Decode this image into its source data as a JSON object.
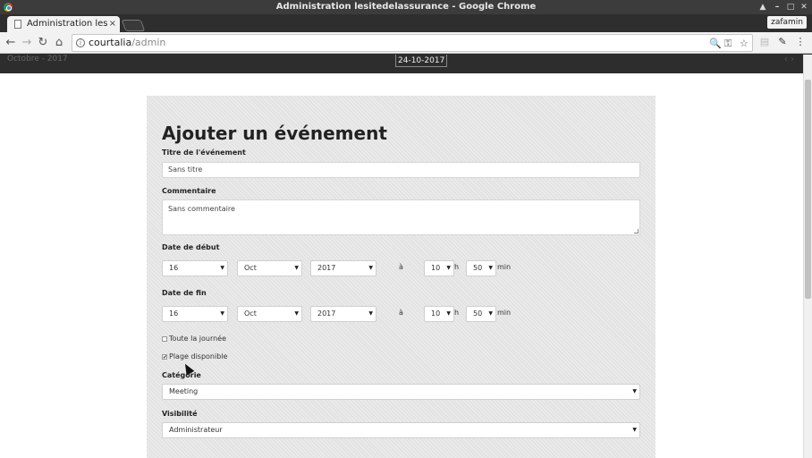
{
  "window": {
    "title": "Administration lesitedelassurance - Google Chrome",
    "controls": [
      "▲",
      "–",
      "□",
      "✕"
    ]
  },
  "tabs": [
    {
      "label": "Administration lesit",
      "close": "×"
    }
  ],
  "profile": {
    "name": "zafamin"
  },
  "toolbar": {
    "back": "←",
    "forward": "→",
    "reload": "↻",
    "home": "⌂",
    "url_host": "courtalia",
    "url_path": "/admin",
    "info": "i",
    "zoom_icon": "🔍",
    "key_icon": "⚿",
    "star_icon": "☆",
    "menu_icon": "⋮"
  },
  "calendar_bar": {
    "month": "Octobre - 2017",
    "date": "24-10-2017",
    "arrows": "‹ ›"
  },
  "form": {
    "title": "Ajouter un événement",
    "event_title": {
      "label": "Titre de l'événement",
      "value": "Sans titre"
    },
    "comment": {
      "label": "Commentaire",
      "value": "Sans commentaire"
    },
    "start": {
      "label": "Date de début",
      "day": "16",
      "month": "Oct",
      "year": "2017",
      "at": "à",
      "hour": "10",
      "h": "h",
      "minute": "50",
      "min": "min"
    },
    "end": {
      "label": "Date de fin",
      "day": "16",
      "month": "Oct",
      "year": "2017",
      "at": "à",
      "hour": "10",
      "h": "h",
      "minute": "50",
      "min": "min"
    },
    "all_day": {
      "label": "Toute la journée",
      "checked": false
    },
    "available": {
      "label": "Plage disponible",
      "checked": true,
      "mark": "✔"
    },
    "category": {
      "label": "Catégorie",
      "value": "Meeting"
    },
    "visibility": {
      "label": "Visibilité",
      "value": "Administrateur"
    },
    "caret": "▼"
  },
  "colors": {
    "panel_bg": "#e3e3e3",
    "dark_bar": "#2d2d2d",
    "title_bar": "#3c3c3c"
  }
}
